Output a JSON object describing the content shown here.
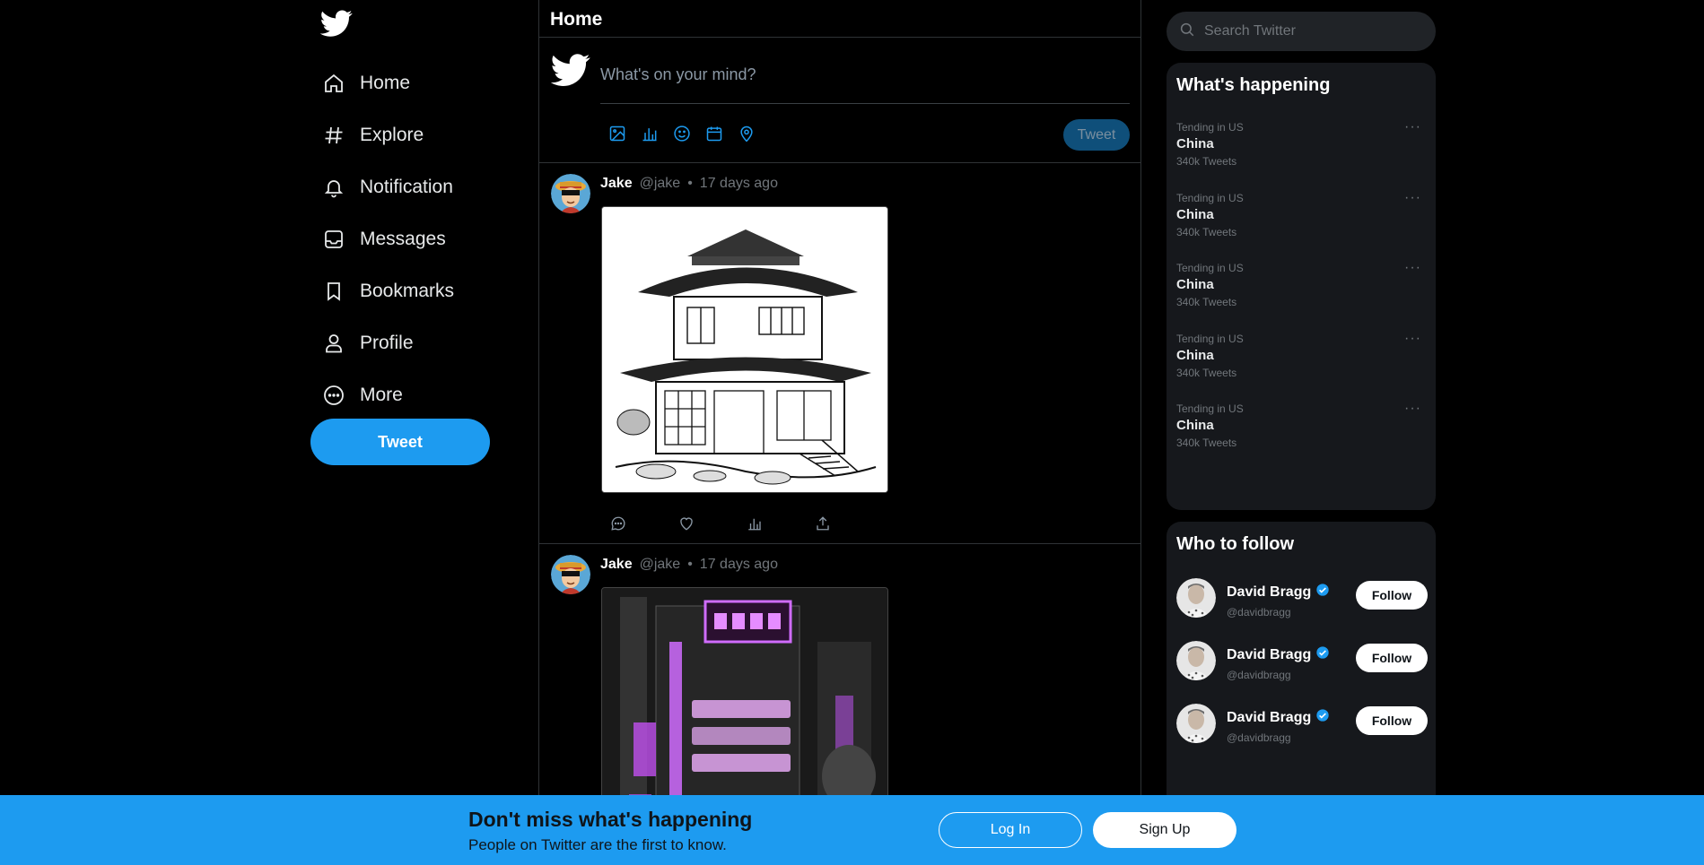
{
  "brand": {
    "logo": "twitter-bird-icon",
    "accent": "#1d9bf0"
  },
  "nav": {
    "items": [
      {
        "label": "Home",
        "icon": "home-icon"
      },
      {
        "label": "Explore",
        "icon": "hashtag-icon"
      },
      {
        "label": "Notification",
        "icon": "bell-icon"
      },
      {
        "label": "Messages",
        "icon": "inbox-icon"
      },
      {
        "label": "Bookmarks",
        "icon": "bookmark-icon"
      },
      {
        "label": "Profile",
        "icon": "person-icon"
      },
      {
        "label": "More",
        "icon": "more-circle-icon"
      }
    ],
    "tweet_label": "Tweet"
  },
  "feed": {
    "title": "Home",
    "composer": {
      "placeholder": "What's on your mind?",
      "tweet_label": "Tweet",
      "tools": [
        "image-icon",
        "poll-icon",
        "emoji-icon",
        "schedule-icon",
        "location-icon"
      ]
    },
    "posts": [
      {
        "name": "Jake",
        "handle": "@jake",
        "time": "17 days ago",
        "image": "pagoda-house-sketch"
      },
      {
        "name": "Jake",
        "handle": "@jake",
        "time": "17 days ago",
        "image": "neon-city-building"
      }
    ],
    "actions": [
      "reply-icon",
      "like-icon",
      "stats-icon",
      "share-icon"
    ]
  },
  "search": {
    "placeholder": "Search Twitter"
  },
  "happening": {
    "title": "What's happening",
    "trends": [
      {
        "category": "Tending in US",
        "name": "China",
        "count": "340k Tweets"
      },
      {
        "category": "Tending in US",
        "name": "China",
        "count": "340k Tweets"
      },
      {
        "category": "Tending in US",
        "name": "China",
        "count": "340k Tweets"
      },
      {
        "category": "Tending in US",
        "name": "China",
        "count": "340k Tweets"
      },
      {
        "category": "Tending in US",
        "name": "China",
        "count": "340k Tweets"
      }
    ],
    "more_glyph": "···"
  },
  "who_to_follow": {
    "title": "Who to follow",
    "users": [
      {
        "name": "David Bragg",
        "handle": "@davidbragg",
        "button": "Follow",
        "verified": true
      },
      {
        "name": "David Bragg",
        "handle": "@davidbragg",
        "button": "Follow",
        "verified": true
      },
      {
        "name": "David Bragg",
        "handle": "@davidbragg",
        "button": "Follow",
        "verified": true
      }
    ]
  },
  "bottom_bar": {
    "title": "Don't miss what's happening",
    "subtitle": "People on Twitter are the first to know.",
    "login_label": "Log In",
    "signup_label": "Sign Up"
  }
}
